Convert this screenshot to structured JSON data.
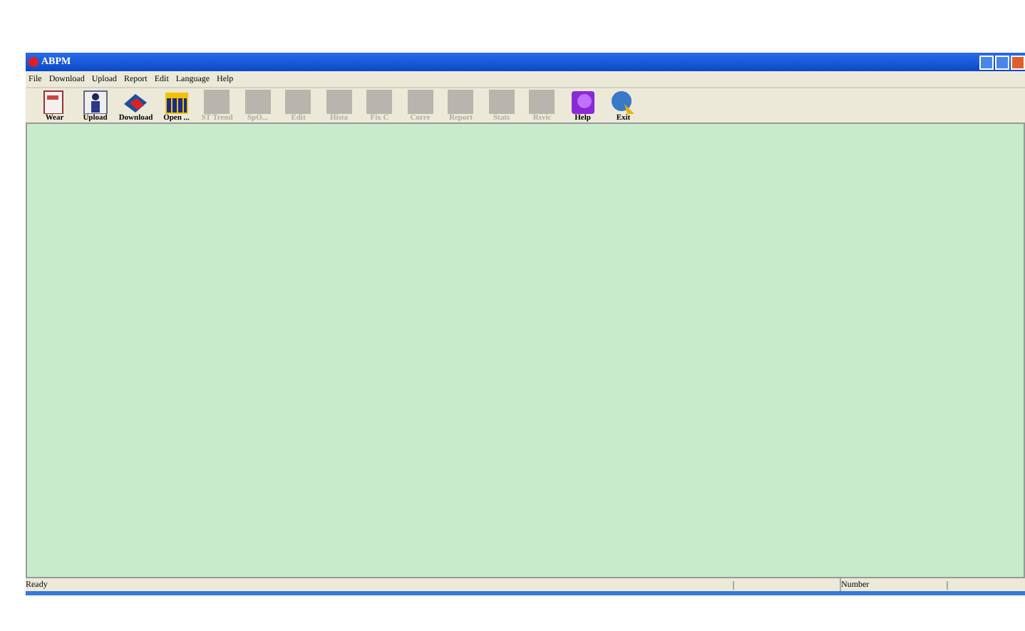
{
  "window": {
    "title": "ABPM"
  },
  "menu": [
    "File",
    "Download",
    "Upload",
    "Report",
    "Edit",
    "Language",
    "Help"
  ],
  "toolbar": [
    {
      "label": "Wear",
      "kind": "wear",
      "disabled": false
    },
    {
      "label": "Upload",
      "kind": "upload",
      "disabled": false
    },
    {
      "label": "Download",
      "kind": "download",
      "disabled": false
    },
    {
      "label": "Open ...",
      "kind": "open",
      "disabled": false
    },
    {
      "label": "ST Trend",
      "kind": "plain",
      "disabled": true
    },
    {
      "label": "SpO...",
      "kind": "plain",
      "disabled": true
    },
    {
      "label": "Edit",
      "kind": "plain",
      "disabled": true
    },
    {
      "label": "Hista",
      "kind": "plain",
      "disabled": true
    },
    {
      "label": "Fix C",
      "kind": "plain",
      "disabled": true
    },
    {
      "label": "Corre",
      "kind": "plain",
      "disabled": true
    },
    {
      "label": "Report",
      "kind": "plain",
      "disabled": true
    },
    {
      "label": "Stats",
      "kind": "plain",
      "disabled": true
    },
    {
      "label": "Rsvic",
      "kind": "plain",
      "disabled": true
    },
    {
      "label": "Help",
      "kind": "help",
      "disabled": false
    },
    {
      "label": "Exit",
      "kind": "exit",
      "disabled": false
    }
  ],
  "status_bar": [
    "Ready",
    "Number"
  ]
}
